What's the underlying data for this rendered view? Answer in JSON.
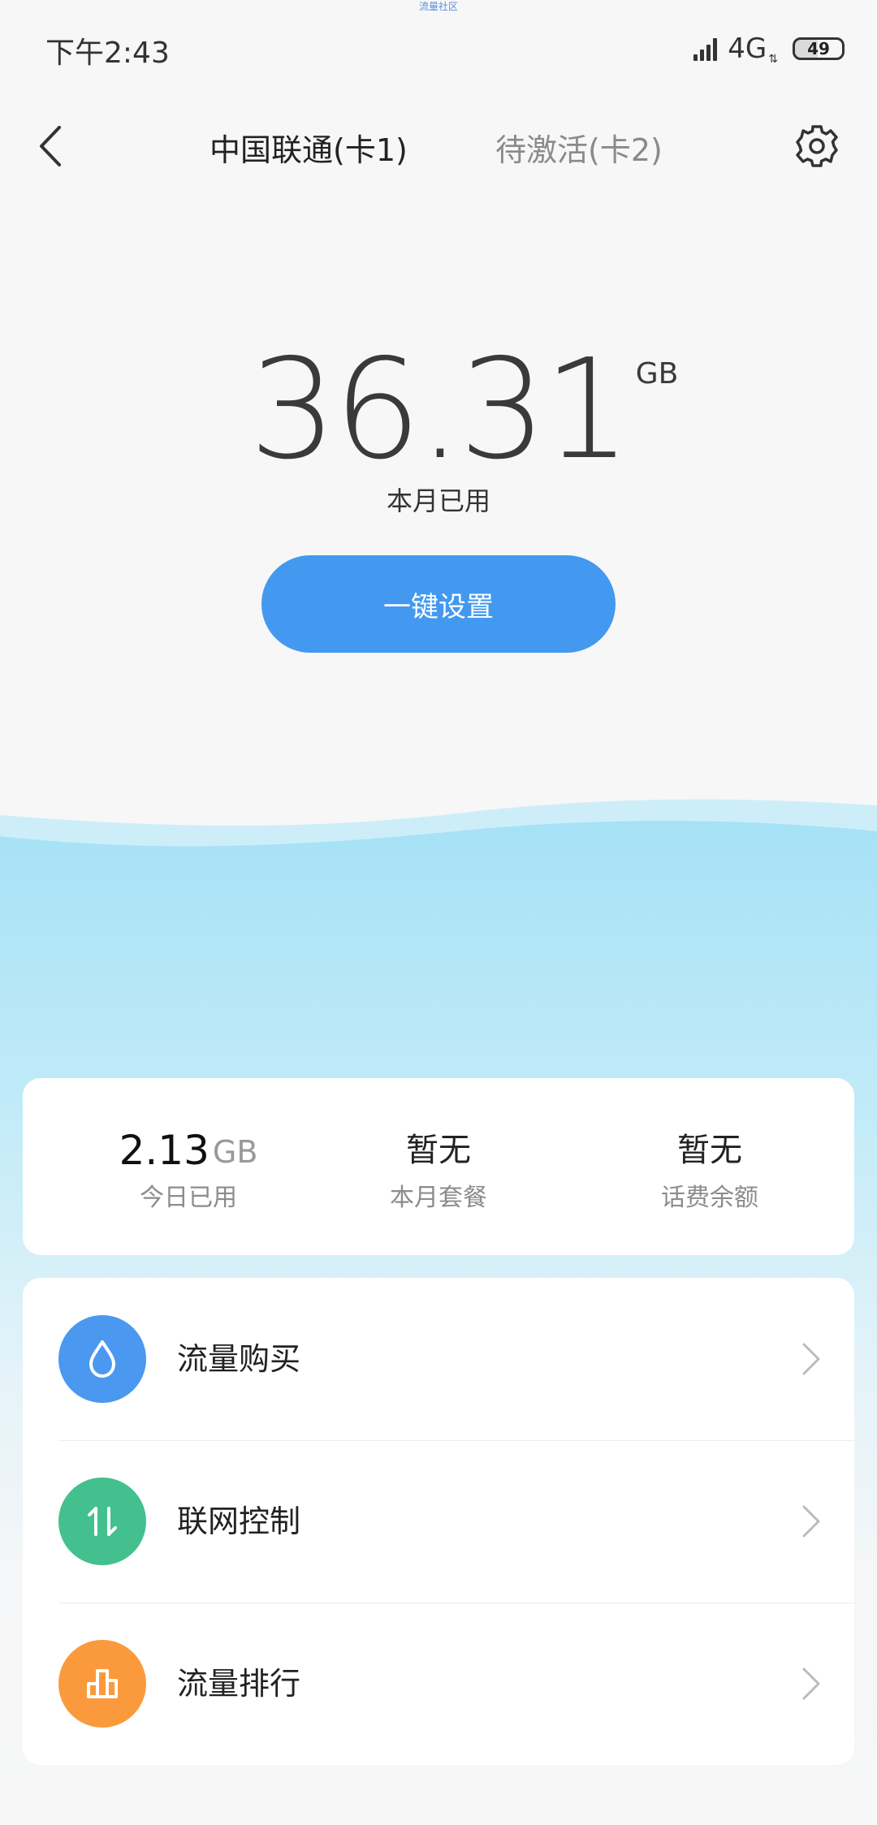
{
  "watermark": "流量社区",
  "status_bar": {
    "time": "下午2:43",
    "network": "4G",
    "battery_level": "49",
    "icons": [
      "signal-icon",
      "data-arrows-icon",
      "battery-icon"
    ]
  },
  "header": {
    "tabs": [
      {
        "label": "中国联通(卡1)",
        "selected": true
      },
      {
        "label": "待激活(卡2)",
        "selected": false
      }
    ],
    "icons": [
      "back-arrow-icon",
      "gear-icon"
    ]
  },
  "usage": {
    "value": "36.31",
    "unit": "GB",
    "label": "本月已用"
  },
  "setup_button": {
    "label": "一键设置",
    "color": "#4399ef"
  },
  "stats": [
    {
      "value": "2.13",
      "unit": "GB",
      "label": "今日已用"
    },
    {
      "value": "暂无",
      "label": "本月套餐"
    },
    {
      "value": "暂无",
      "label": "话费余额"
    }
  ],
  "menu": [
    {
      "label": "流量购买",
      "icon": "water-drop-icon",
      "color": "#4a98f0"
    },
    {
      "label": "联网控制",
      "icon": "up-down-arrows-icon",
      "color": "#43c08e"
    },
    {
      "label": "流量排行",
      "icon": "bar-chart-icon",
      "color": "#fb9a3c"
    }
  ],
  "colors": {
    "background": "#f7f7f7",
    "accent": "#4399ef",
    "wave": "#a6e1f6"
  }
}
